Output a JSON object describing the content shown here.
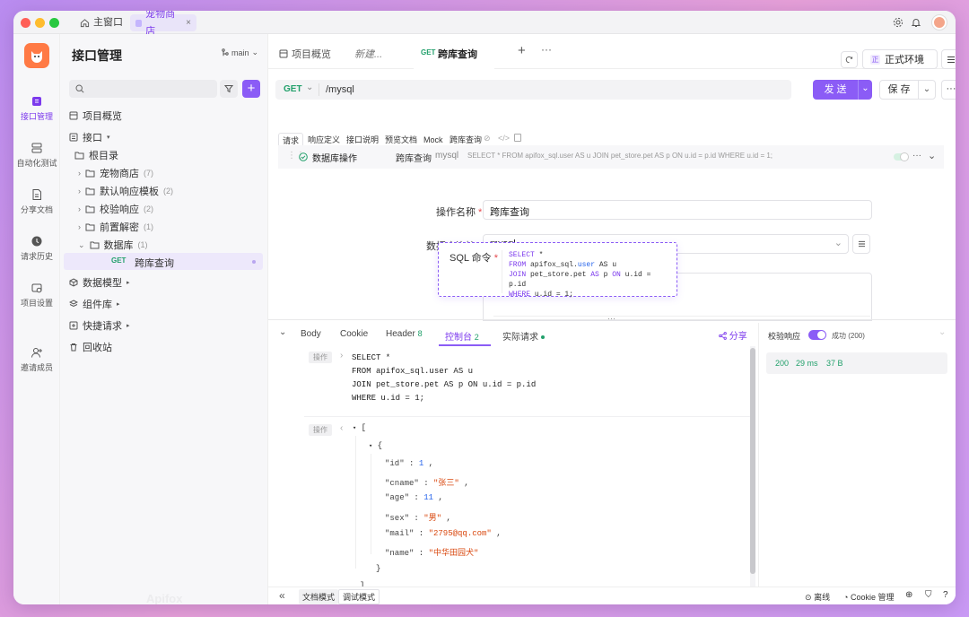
{
  "titlebar": {
    "home_tab": "主窗口",
    "project_tab": "宠物商店"
  },
  "rail": {
    "items": [
      {
        "label": "接口管理",
        "icon": "api-icon"
      },
      {
        "label": "自动化测试",
        "icon": "automation-icon"
      },
      {
        "label": "分享文档",
        "icon": "share-doc-icon"
      },
      {
        "label": "请求历史",
        "icon": "history-icon"
      },
      {
        "label": "项目设置",
        "icon": "settings-icon"
      },
      {
        "label": "邀请成员",
        "icon": "invite-icon"
      }
    ]
  },
  "sidebar": {
    "title": "接口管理",
    "branch": "main",
    "search_placeholder": "",
    "overview": "项目概览",
    "api": "接口",
    "root": "根目录",
    "folders": [
      {
        "name": "宠物商店",
        "count": "(7)"
      },
      {
        "name": "默认响应模板",
        "count": "(2)"
      },
      {
        "name": "校验响应",
        "count": "(2)"
      },
      {
        "name": "前置解密",
        "count": "(1)"
      },
      {
        "name": "数据库",
        "count": "(1)"
      }
    ],
    "active_method": "GET",
    "active_name": "跨库查询",
    "data_model": "数据模型",
    "components": "组件库",
    "quick_request": "快捷请求",
    "recycle": "回收站",
    "watermark": "Apifox"
  },
  "tabs": {
    "items": [
      "项目概览",
      "新建...",
      "跨库查询"
    ],
    "active_method": "GET",
    "env": "正式环境"
  },
  "request": {
    "method": "GET",
    "path": "/mysql",
    "send": "发 送",
    "save": "保 存"
  },
  "subtabs": [
    "请求",
    "响应定义",
    "接口说明",
    "预览文档",
    "Mock",
    "跨库查询"
  ],
  "db_op": {
    "title": "数据库操作",
    "name": "跨库查询",
    "conn": "mysql",
    "preview": "SELECT * FROM apifox_sql.user AS u JOIN pet_store.pet AS p ON u.id = p.id WHERE u.id = 1;",
    "name_label": "操作名称",
    "name_value": "跨库查询",
    "conn_label": "数据库连接",
    "conn_value": "mysql",
    "sql_label": "SQL 命令"
  },
  "sql": {
    "l1a": "SELECT",
    "l1b": " *",
    "l2a": "FROM",
    "l2b": " apifox_sql.",
    "l2c": "user",
    "l2d": " AS u",
    "l3a": "JOIN",
    "l3b": " pet_store.pet ",
    "l3c": "AS",
    "l3d": " p ",
    "l3e": "ON",
    "l3f": " u.id = p.id",
    "l4a": "WHERE",
    "l4b": " u.id = 1;"
  },
  "resp_tabs": {
    "items": [
      {
        "label": "Body",
        "badge": ""
      },
      {
        "label": "Cookie",
        "badge": ""
      },
      {
        "label": "Header",
        "badge": "8"
      },
      {
        "label": "控制台",
        "badge": "2"
      },
      {
        "label": "实际请求",
        "badge": ""
      }
    ],
    "share": "分享"
  },
  "console": {
    "tag": "操作",
    "sql_lines": [
      "SELECT *",
      "FROM apifox_sql.user AS u",
      "JOIN pet_store.pet AS p ON u.id = p.id",
      "WHERE u.id = 1;"
    ],
    "open_bracket": "[",
    "open_brace": "{",
    "close_brace": "}",
    "close_bracket": "]",
    "rows": [
      {
        "key": "\"id\"",
        "value": "1",
        "kind": "num"
      },
      {
        "key": "\"cname\"",
        "value": "\"张三\"",
        "kind": "str"
      },
      {
        "key": "\"age\"",
        "value": "11",
        "kind": "num"
      },
      {
        "key": "\"sex\"",
        "value": "\"男\"",
        "kind": "str"
      },
      {
        "key": "\"mail\"",
        "value": "\"2795@qq.com\"",
        "kind": "str"
      },
      {
        "key": "\"name\"",
        "value": "\"中华田园犬\"",
        "kind": "str"
      }
    ]
  },
  "right_panel": {
    "validate": "校验响应",
    "status_text": "成功 (200)",
    "code": "200",
    "time": "29 ms",
    "size": "37 B"
  },
  "footer": {
    "doc_mode": "文档模式",
    "debug_mode": "调试模式",
    "offline": "离线",
    "cookie": "Cookie 管理"
  },
  "colors": {
    "accent": "#8b5cf6",
    "get": "#22a06b",
    "orange": "#d9480f"
  }
}
